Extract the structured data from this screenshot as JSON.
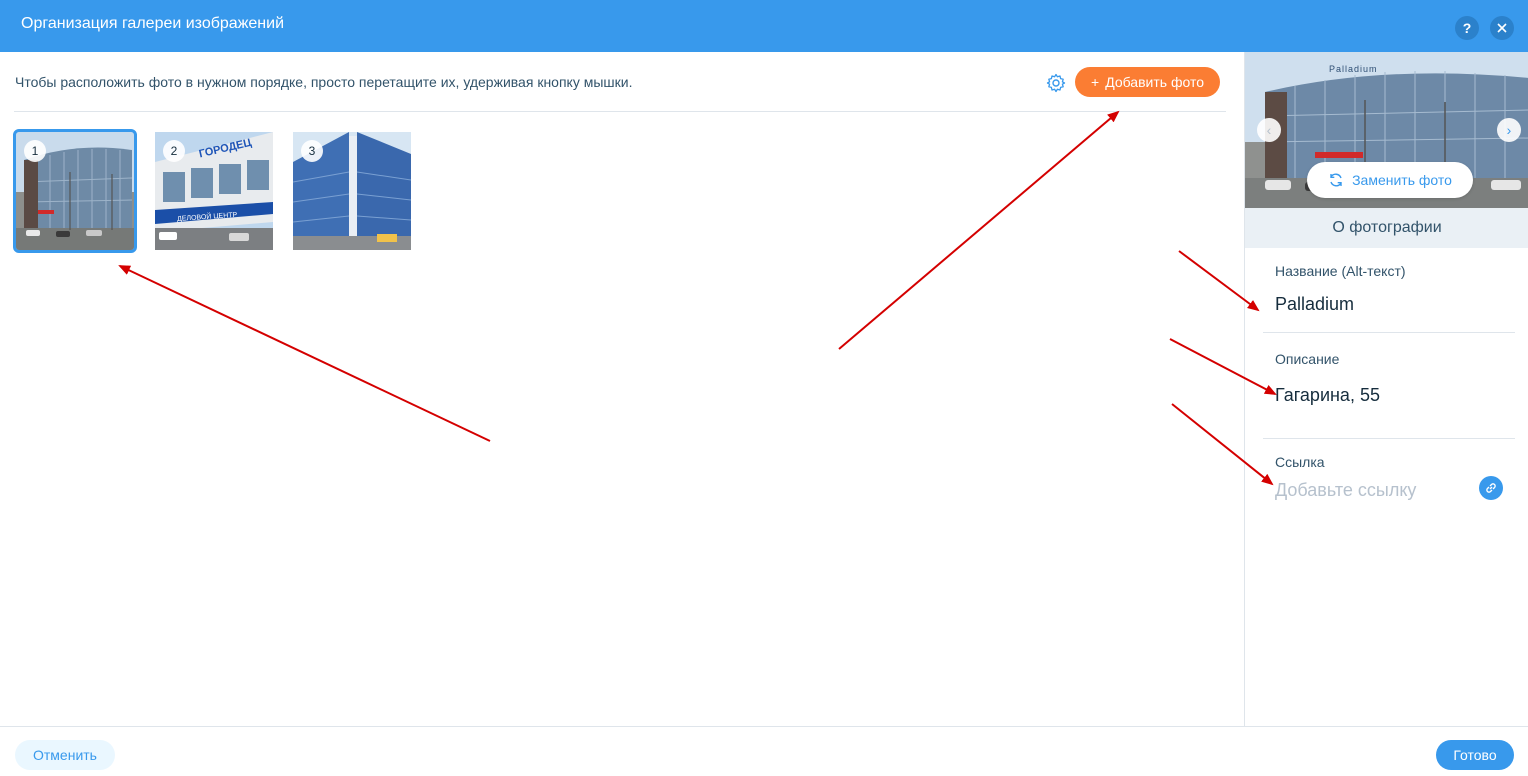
{
  "header": {
    "title": "Организация галереи изображений",
    "help_label": "?",
    "close_label": "✕"
  },
  "main": {
    "instruction": "Чтобы расположить фото в нужном порядке, просто перетащите их, удерживая кнопку мышки.",
    "add_photo_label": "Добавить фото",
    "add_photo_plus": "+",
    "thumbnails": [
      {
        "number": "1",
        "selected": true
      },
      {
        "number": "2",
        "selected": false
      },
      {
        "number": "3",
        "selected": false
      }
    ],
    "thumb_sign_2_text": "ГОРОДЕЦ",
    "thumb_sign_2_banner": "ДЕЛОВОЙ ЦЕНТР",
    "preview_sign_text": "Palladium"
  },
  "side": {
    "replace_photo_label": "Заменить фото",
    "nav_prev": "‹",
    "nav_next": "›",
    "about_title": "О фотографии",
    "name_label": "Название (Alt-текст)",
    "name_value": "Palladium",
    "description_label": "Описание",
    "description_value": "Гагарина, 55",
    "link_label": "Ссылка",
    "link_placeholder": "Добавьте ссылку"
  },
  "footer": {
    "cancel_label": "Отменить",
    "done_label": "Готово"
  },
  "colors": {
    "accent": "#3899ec",
    "orange": "#fb7d33",
    "annotation_red": "#d40000"
  }
}
